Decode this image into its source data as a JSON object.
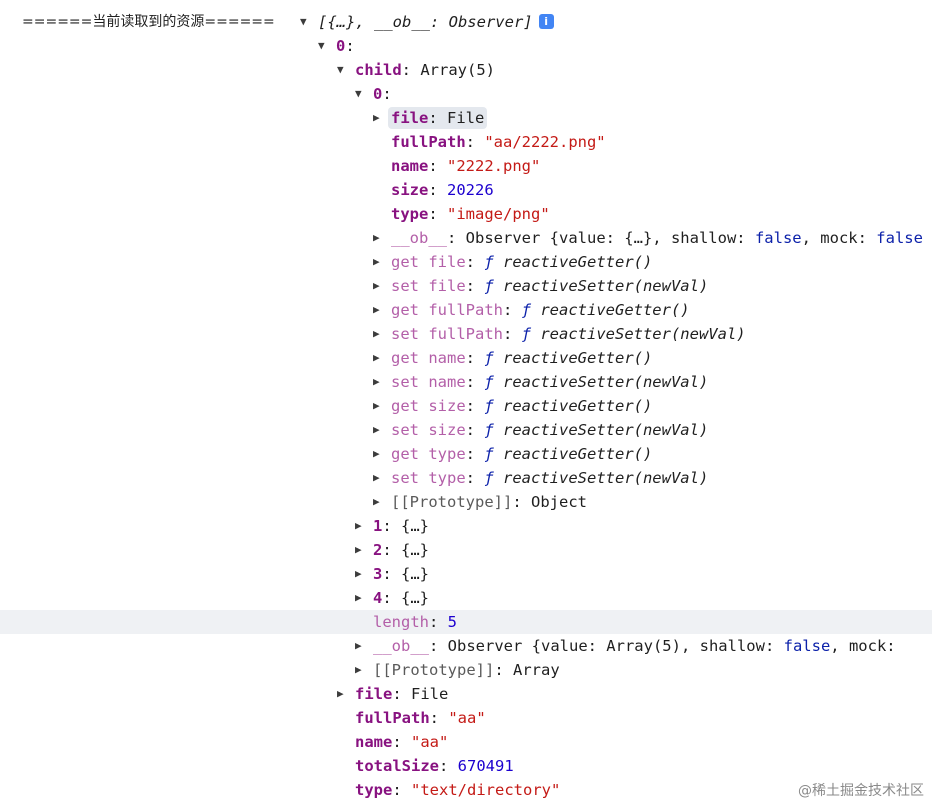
{
  "console": {
    "log_label": "======当前读取到的资源======",
    "watermark": "@稀土掘金技术社区",
    "rows": [
      {
        "indent": 300,
        "arrow": "down",
        "summary": "[{…}, __ob__: Observer]",
        "info": "i"
      },
      {
        "indent": 318,
        "arrow": "down",
        "key": "0",
        "sep": ":",
        "vkind": "obj",
        "value": ""
      },
      {
        "indent": 337,
        "arrow": "down",
        "key": "child",
        "sep": ": ",
        "vkind": "obj",
        "value": "Array(5)"
      },
      {
        "indent": 355,
        "arrow": "down",
        "key": "0",
        "sep": ":",
        "vkind": "obj",
        "value": ""
      },
      {
        "indent": 373,
        "arrow": "right",
        "key": "file",
        "sep": ": ",
        "vkind": "obj",
        "value": "File",
        "pill": true
      },
      {
        "indent": 373,
        "arrow": "none",
        "key": "fullPath",
        "sep": ": ",
        "vkind": "str",
        "value": "\"aa/2222.png\""
      },
      {
        "indent": 373,
        "arrow": "none",
        "key": "name",
        "sep": ": ",
        "vkind": "str",
        "value": "\"2222.png\""
      },
      {
        "indent": 373,
        "arrow": "none",
        "key": "size",
        "sep": ": ",
        "vkind": "num",
        "value": "20226"
      },
      {
        "indent": 373,
        "arrow": "none",
        "key": "type",
        "sep": ": ",
        "vkind": "str",
        "value": "\"image/png\""
      },
      {
        "indent": 373,
        "arrow": "right",
        "key": "__ob__",
        "keystyle": "dim",
        "sep": ": ",
        "vkind": "observer",
        "value": "Observer {value: {…}, shallow: false, mock: false"
      },
      {
        "indent": 373,
        "arrow": "right",
        "accessor": "get",
        "key": "file",
        "keystyle": "dim",
        "sep": ": ",
        "vkind": "fn",
        "fn": "ƒ",
        "value": "reactiveGetter()"
      },
      {
        "indent": 373,
        "arrow": "right",
        "accessor": "set",
        "key": "file",
        "keystyle": "dim",
        "sep": ": ",
        "vkind": "fn",
        "fn": "ƒ",
        "value": "reactiveSetter(newVal)"
      },
      {
        "indent": 373,
        "arrow": "right",
        "accessor": "get",
        "key": "fullPath",
        "keystyle": "dim",
        "sep": ": ",
        "vkind": "fn",
        "fn": "ƒ",
        "value": "reactiveGetter()"
      },
      {
        "indent": 373,
        "arrow": "right",
        "accessor": "set",
        "key": "fullPath",
        "keystyle": "dim",
        "sep": ": ",
        "vkind": "fn",
        "fn": "ƒ",
        "value": "reactiveSetter(newVal)"
      },
      {
        "indent": 373,
        "arrow": "right",
        "accessor": "get",
        "key": "name",
        "keystyle": "dim",
        "sep": ": ",
        "vkind": "fn",
        "fn": "ƒ",
        "value": "reactiveGetter()"
      },
      {
        "indent": 373,
        "arrow": "right",
        "accessor": "set",
        "key": "name",
        "keystyle": "dim",
        "sep": ": ",
        "vkind": "fn",
        "fn": "ƒ",
        "value": "reactiveSetter(newVal)"
      },
      {
        "indent": 373,
        "arrow": "right",
        "accessor": "get",
        "key": "size",
        "keystyle": "dim",
        "sep": ": ",
        "vkind": "fn",
        "fn": "ƒ",
        "value": "reactiveGetter()"
      },
      {
        "indent": 373,
        "arrow": "right",
        "accessor": "set",
        "key": "size",
        "keystyle": "dim",
        "sep": ": ",
        "vkind": "fn",
        "fn": "ƒ",
        "value": "reactiveSetter(newVal)"
      },
      {
        "indent": 373,
        "arrow": "right",
        "accessor": "get",
        "key": "type",
        "keystyle": "dim",
        "sep": ": ",
        "vkind": "fn",
        "fn": "ƒ",
        "value": "reactiveGetter()"
      },
      {
        "indent": 373,
        "arrow": "right",
        "accessor": "set",
        "key": "type",
        "keystyle": "dim",
        "sep": ": ",
        "vkind": "fn",
        "fn": "ƒ",
        "value": "reactiveSetter(newVal)"
      },
      {
        "indent": 373,
        "arrow": "right",
        "key": "[[Prototype]]",
        "keystyle": "plain",
        "sep": ": ",
        "vkind": "obj",
        "value": "Object"
      },
      {
        "indent": 355,
        "arrow": "right",
        "key": "1",
        "sep": ": ",
        "vkind": "obj",
        "value": "{…}"
      },
      {
        "indent": 355,
        "arrow": "right",
        "key": "2",
        "sep": ": ",
        "vkind": "obj",
        "value": "{…}"
      },
      {
        "indent": 355,
        "arrow": "right",
        "key": "3",
        "sep": ": ",
        "vkind": "obj",
        "value": "{…}"
      },
      {
        "indent": 355,
        "arrow": "right",
        "key": "4",
        "sep": ": ",
        "vkind": "obj",
        "value": "{…}"
      },
      {
        "indent": 355,
        "arrow": "none",
        "key": "length",
        "keystyle": "dim",
        "sep": ": ",
        "vkind": "num",
        "value": "5",
        "highlight": true
      },
      {
        "indent": 355,
        "arrow": "right",
        "key": "__ob__",
        "keystyle": "dim",
        "sep": ": ",
        "vkind": "observer",
        "value": "Observer {value: Array(5), shallow: false, mock: "
      },
      {
        "indent": 355,
        "arrow": "right",
        "key": "[[Prototype]]",
        "keystyle": "plain",
        "sep": ": ",
        "vkind": "obj",
        "value": "Array"
      },
      {
        "indent": 337,
        "arrow": "right",
        "key": "file",
        "sep": ": ",
        "vkind": "obj",
        "value": "File"
      },
      {
        "indent": 337,
        "arrow": "none",
        "key": "fullPath",
        "sep": ": ",
        "vkind": "str",
        "value": "\"aa\""
      },
      {
        "indent": 337,
        "arrow": "none",
        "key": "name",
        "sep": ": ",
        "vkind": "str",
        "value": "\"aa\""
      },
      {
        "indent": 337,
        "arrow": "none",
        "key": "totalSize",
        "sep": ": ",
        "vkind": "num",
        "value": "670491"
      },
      {
        "indent": 337,
        "arrow": "none",
        "key": "type",
        "sep": ": ",
        "vkind": "str",
        "value": "\"text/directory\""
      }
    ]
  }
}
